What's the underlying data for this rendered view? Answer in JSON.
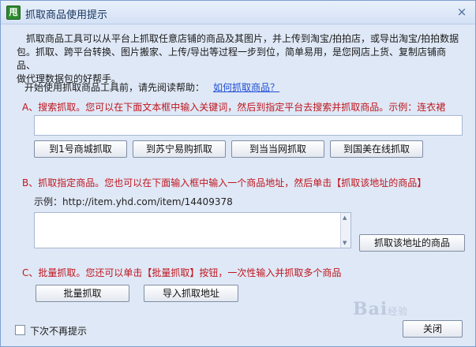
{
  "window": {
    "app_icon_glyph": "甩",
    "title": "抓取商品使用提示",
    "close_glyph": "×"
  },
  "intro": {
    "line1": "抓取商品工具可以从平台上抓取任意店铺的商品及其图片，并上传到淘宝/拍拍店，或导出淘宝/拍拍数据",
    "line2": "包。抓取、跨平台转换、图片搬家、上传/导出等过程一步到位，简单易用，是您网店上货、复制店铺商品、",
    "line3": "做代理数据包的好帮手。"
  },
  "help": {
    "label": "开始使用抓取商品工具前，请先阅读帮助：",
    "link": "如何抓取商品？"
  },
  "section_a": {
    "title": "A、搜索抓取。您可以在下面文本框中输入关键词，然后到指定平台去搜索并抓取商品。示例：连衣裙",
    "input_value": "",
    "buttons": [
      "到1号商城抓取",
      "到苏宁易购抓取",
      "到当当网抓取",
      "到国美在线抓取"
    ]
  },
  "section_b": {
    "title": "B、抓取指定商品。您也可以在下面输入框中输入一个商品地址，然后单击【抓取该地址的商品】",
    "example": "示例：http://item.yhd.com/item/14409378",
    "input_value": "",
    "button": "抓取该地址的商品"
  },
  "section_c": {
    "title": "C、批量抓取。您还可以单击【批量抓取】按钮，一次性输入并抓取多个商品",
    "buttons": [
      "批量抓取",
      "导入抓取地址"
    ]
  },
  "footer": {
    "checkbox_label": "下次不再提示",
    "checkbox_checked": false,
    "close_button": "关闭"
  },
  "watermark": {
    "brand": "Bai",
    "suffix": "经验"
  },
  "colors": {
    "accent_red": "#c0151d",
    "link_blue": "#1f4fd6",
    "window_bg": "#dfe8f6"
  }
}
